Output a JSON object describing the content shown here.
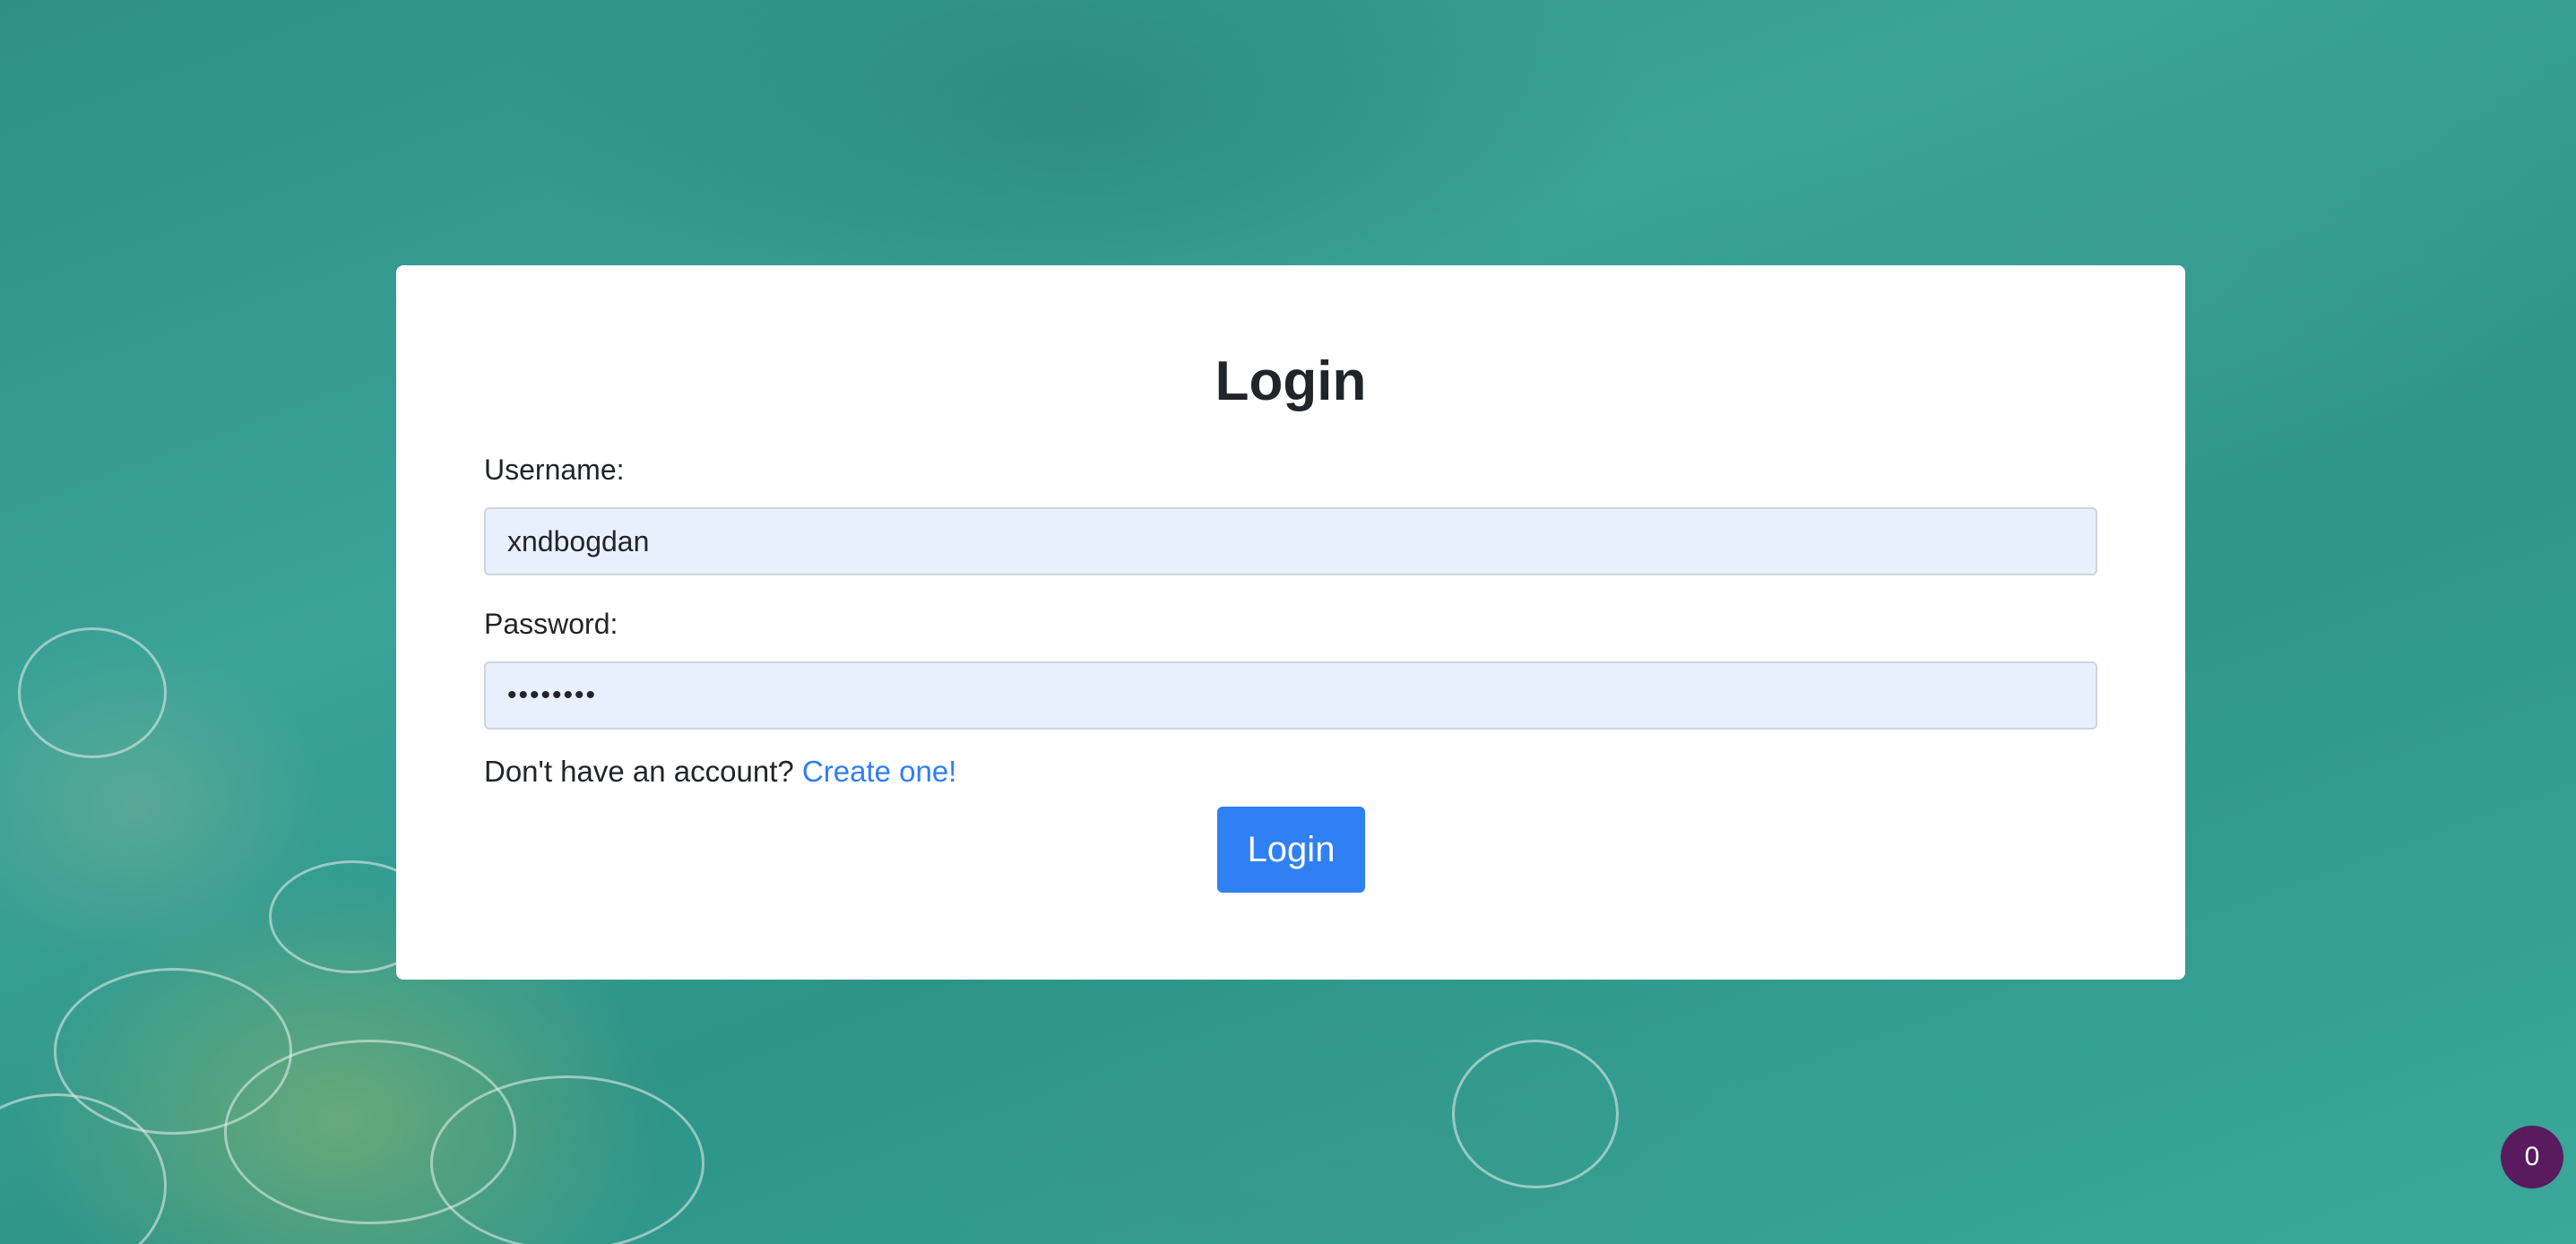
{
  "login": {
    "title": "Login",
    "username_label": "Username:",
    "username_value": "xndbogdan",
    "password_label": "Password:",
    "password_value": "••••••••",
    "signup_prompt": "Don't have an account?",
    "signup_link": "Create one!",
    "submit_label": "Login"
  },
  "badge": {
    "count": "0"
  },
  "colors": {
    "accent": "#2f80f3",
    "link": "#2f7ff1",
    "input_background": "#e8f0fe",
    "badge": "#5a1a5e"
  }
}
